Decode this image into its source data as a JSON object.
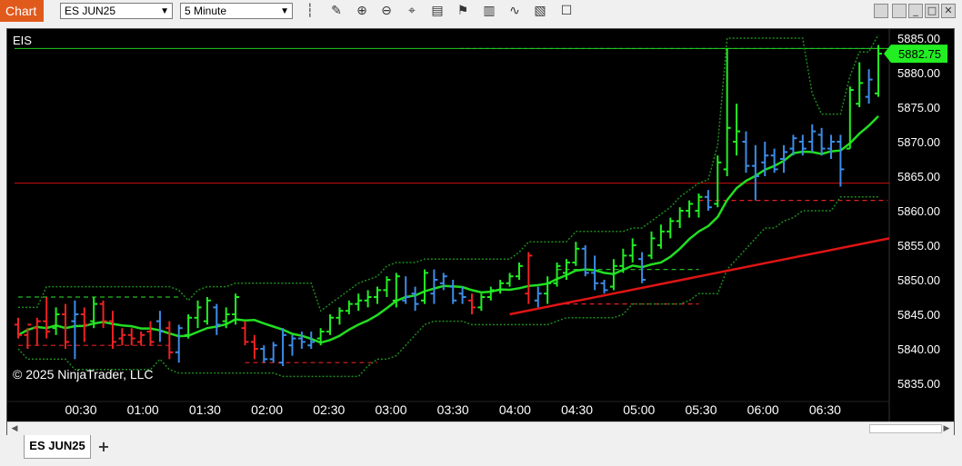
{
  "window": {
    "title": "Chart"
  },
  "toolbar": {
    "instrument": "ES JUN25",
    "interval": "5 Minute",
    "icons": [
      "bars-type-icon",
      "draw-pencil-icon",
      "zoom-in-icon",
      "zoom-out-icon",
      "crosshair-icon",
      "properties-icon",
      "strategies-icon",
      "indicators-icon",
      "templates-icon",
      "chart-trader-icon",
      "data-box-icon",
      "snapshot-icon"
    ]
  },
  "chart": {
    "instrument_label": "EIS",
    "copyright": "© 2025 NinjaTrader, LLC",
    "last_price_label": "5882.75",
    "colors": {
      "background": "#000000",
      "up": "#22ee22",
      "down": "#ee2222",
      "neutral": "#3c8ce8",
      "ma": "#22dd22",
      "trend": "#e01414"
    }
  },
  "chart_data": {
    "type": "candlestick",
    "instrument": "ES JUN25",
    "interval": "5 Minute",
    "ylim": [
      5832,
      5886
    ],
    "yticks": [
      "5885.00",
      "5880.00",
      "5875.00",
      "5870.00",
      "5865.00",
      "5860.00",
      "5855.00",
      "5850.00",
      "5845.00",
      "5840.00",
      "5835.00"
    ],
    "xticks": [
      "00:30",
      "01:00",
      "01:30",
      "02:00",
      "02:30",
      "03:00",
      "03:30",
      "04:00",
      "04:30",
      "05:00",
      "05:30",
      "06:00",
      "06:30"
    ],
    "last_price": 5882.75,
    "horizontal_lines": [
      5883.5,
      5864.0
    ],
    "bars": [
      {
        "o": 5843.5,
        "h": 5844.5,
        "l": 5841.5,
        "c": 5842.0,
        "d": "down"
      },
      {
        "o": 5842.0,
        "h": 5843.0,
        "l": 5840.0,
        "c": 5843.5,
        "d": "down"
      },
      {
        "o": 5843.0,
        "h": 5844.5,
        "l": 5840.5,
        "c": 5844.0,
        "d": "down"
      },
      {
        "o": 5844.0,
        "h": 5847.5,
        "l": 5841.5,
        "c": 5842.5,
        "d": "down"
      },
      {
        "o": 5843.0,
        "h": 5846.0,
        "l": 5842.0,
        "c": 5845.0,
        "d": "up"
      },
      {
        "o": 5845.0,
        "h": 5846.5,
        "l": 5840.0,
        "c": 5841.0,
        "d": "down"
      },
      {
        "o": 5844.0,
        "h": 5847.0,
        "l": 5838.5,
        "c": 5845.0,
        "d": "neutral"
      },
      {
        "o": 5845.0,
        "h": 5846.0,
        "l": 5841.0,
        "c": 5843.5,
        "d": "down"
      },
      {
        "o": 5844.0,
        "h": 5847.5,
        "l": 5843.0,
        "c": 5846.5,
        "d": "up"
      },
      {
        "o": 5846.5,
        "h": 5847.0,
        "l": 5843.0,
        "c": 5844.0,
        "d": "down"
      },
      {
        "o": 5844.0,
        "h": 5845.5,
        "l": 5840.0,
        "c": 5841.0,
        "d": "down"
      },
      {
        "o": 5841.5,
        "h": 5843.0,
        "l": 5840.5,
        "c": 5842.0,
        "d": "down"
      },
      {
        "o": 5842.0,
        "h": 5843.0,
        "l": 5840.5,
        "c": 5841.5,
        "d": "down"
      },
      {
        "o": 5841.0,
        "h": 5842.5,
        "l": 5840.5,
        "c": 5842.0,
        "d": "down"
      },
      {
        "o": 5842.5,
        "h": 5844.0,
        "l": 5840.5,
        "c": 5841.0,
        "d": "down"
      },
      {
        "o": 5844.0,
        "h": 5845.5,
        "l": 5841.0,
        "c": 5842.5,
        "d": "neutral"
      },
      {
        "o": 5843.0,
        "h": 5844.0,
        "l": 5838.5,
        "c": 5839.5,
        "d": "down"
      },
      {
        "o": 5839.5,
        "h": 5843.5,
        "l": 5838.0,
        "c": 5843.0,
        "d": "neutral"
      },
      {
        "o": 5842.0,
        "h": 5845.0,
        "l": 5841.5,
        "c": 5844.5,
        "d": "up"
      },
      {
        "o": 5844.5,
        "h": 5847.0,
        "l": 5843.0,
        "c": 5846.0,
        "d": "up"
      },
      {
        "o": 5844.0,
        "h": 5847.5,
        "l": 5843.5,
        "c": 5847.0,
        "d": "up"
      },
      {
        "o": 5846.0,
        "h": 5846.5,
        "l": 5842.0,
        "c": 5843.5,
        "d": "neutral"
      },
      {
        "o": 5844.0,
        "h": 5846.0,
        "l": 5843.0,
        "c": 5845.0,
        "d": "up"
      },
      {
        "o": 5845.0,
        "h": 5848.0,
        "l": 5843.5,
        "c": 5847.5,
        "d": "up"
      },
      {
        "o": 5843.0,
        "h": 5844.0,
        "l": 5840.5,
        "c": 5841.0,
        "d": "down"
      },
      {
        "o": 5841.0,
        "h": 5842.0,
        "l": 5838.5,
        "c": 5840.0,
        "d": "down"
      },
      {
        "o": 5840.0,
        "h": 5840.5,
        "l": 5838.0,
        "c": 5838.5,
        "d": "neutral"
      },
      {
        "o": 5838.5,
        "h": 5841.0,
        "l": 5838.0,
        "c": 5840.5,
        "d": "neutral"
      },
      {
        "o": 5838.0,
        "h": 5843.0,
        "l": 5837.5,
        "c": 5842.0,
        "d": "neutral"
      },
      {
        "o": 5840.5,
        "h": 5842.0,
        "l": 5839.0,
        "c": 5841.5,
        "d": "neutral"
      },
      {
        "o": 5841.5,
        "h": 5842.5,
        "l": 5840.0,
        "c": 5841.0,
        "d": "neutral"
      },
      {
        "o": 5840.5,
        "h": 5842.5,
        "l": 5840.0,
        "c": 5841.0,
        "d": "neutral"
      },
      {
        "o": 5841.5,
        "h": 5843.0,
        "l": 5840.5,
        "c": 5842.5,
        "d": "up"
      },
      {
        "o": 5842.5,
        "h": 5845.0,
        "l": 5842.0,
        "c": 5844.5,
        "d": "up"
      },
      {
        "o": 5844.5,
        "h": 5846.0,
        "l": 5843.5,
        "c": 5845.5,
        "d": "up"
      },
      {
        "o": 5845.5,
        "h": 5847.0,
        "l": 5845.0,
        "c": 5846.5,
        "d": "up"
      },
      {
        "o": 5846.5,
        "h": 5848.0,
        "l": 5845.5,
        "c": 5847.0,
        "d": "up"
      },
      {
        "o": 5847.0,
        "h": 5848.5,
        "l": 5846.0,
        "c": 5847.5,
        "d": "up"
      },
      {
        "o": 5847.5,
        "h": 5849.0,
        "l": 5846.5,
        "c": 5848.5,
        "d": "up"
      },
      {
        "o": 5848.5,
        "h": 5850.5,
        "l": 5847.5,
        "c": 5850.0,
        "d": "up"
      },
      {
        "o": 5847.0,
        "h": 5851.0,
        "l": 5846.0,
        "c": 5850.5,
        "d": "up"
      },
      {
        "o": 5847.0,
        "h": 5850.5,
        "l": 5846.5,
        "c": 5847.5,
        "d": "neutral"
      },
      {
        "o": 5848.0,
        "h": 5849.0,
        "l": 5845.5,
        "c": 5846.5,
        "d": "neutral"
      },
      {
        "o": 5847.0,
        "h": 5851.5,
        "l": 5846.5,
        "c": 5851.0,
        "d": "up"
      },
      {
        "o": 5848.0,
        "h": 5851.5,
        "l": 5846.5,
        "c": 5850.0,
        "d": "neutral"
      },
      {
        "o": 5849.5,
        "h": 5851.0,
        "l": 5848.5,
        "c": 5850.5,
        "d": "neutral"
      },
      {
        "o": 5849.0,
        "h": 5850.0,
        "l": 5846.5,
        "c": 5847.0,
        "d": "neutral"
      },
      {
        "o": 5848.0,
        "h": 5849.0,
        "l": 5846.5,
        "c": 5847.5,
        "d": "neutral"
      },
      {
        "o": 5847.0,
        "h": 5848.0,
        "l": 5845.0,
        "c": 5846.0,
        "d": "down"
      },
      {
        "o": 5846.0,
        "h": 5848.0,
        "l": 5845.5,
        "c": 5847.5,
        "d": "up"
      },
      {
        "o": 5847.5,
        "h": 5849.0,
        "l": 5847.0,
        "c": 5848.5,
        "d": "up"
      },
      {
        "o": 5848.5,
        "h": 5850.0,
        "l": 5848.0,
        "c": 5849.5,
        "d": "up"
      },
      {
        "o": 5849.5,
        "h": 5851.0,
        "l": 5849.0,
        "c": 5850.5,
        "d": "up"
      },
      {
        "o": 5850.5,
        "h": 5852.5,
        "l": 5850.0,
        "c": 5852.0,
        "d": "up"
      },
      {
        "o": 5848.0,
        "h": 5854.0,
        "l": 5846.5,
        "c": 5853.5,
        "d": "down"
      },
      {
        "o": 5847.0,
        "h": 5849.0,
        "l": 5846.0,
        "c": 5848.0,
        "d": "neutral"
      },
      {
        "o": 5848.0,
        "h": 5850.5,
        "l": 5846.5,
        "c": 5849.5,
        "d": "up"
      },
      {
        "o": 5849.5,
        "h": 5852.5,
        "l": 5849.0,
        "c": 5852.0,
        "d": "up"
      },
      {
        "o": 5851.0,
        "h": 5853.0,
        "l": 5850.0,
        "c": 5852.5,
        "d": "up"
      },
      {
        "o": 5852.5,
        "h": 5855.5,
        "l": 5852.0,
        "c": 5854.5,
        "d": "up"
      },
      {
        "o": 5854.5,
        "h": 5855.0,
        "l": 5850.5,
        "c": 5851.0,
        "d": "neutral"
      },
      {
        "o": 5851.0,
        "h": 5853.5,
        "l": 5848.5,
        "c": 5849.5,
        "d": "neutral"
      },
      {
        "o": 5849.5,
        "h": 5850.0,
        "l": 5848.0,
        "c": 5848.5,
        "d": "neutral"
      },
      {
        "o": 5849.0,
        "h": 5853.0,
        "l": 5848.5,
        "c": 5852.0,
        "d": "up"
      },
      {
        "o": 5852.0,
        "h": 5854.5,
        "l": 5851.0,
        "c": 5853.5,
        "d": "up"
      },
      {
        "o": 5853.5,
        "h": 5856.0,
        "l": 5852.5,
        "c": 5855.0,
        "d": "up"
      },
      {
        "o": 5853.0,
        "h": 5854.0,
        "l": 5849.5,
        "c": 5850.0,
        "d": "neutral"
      },
      {
        "o": 5853.5,
        "h": 5857.0,
        "l": 5853.0,
        "c": 5856.0,
        "d": "up"
      },
      {
        "o": 5855.0,
        "h": 5858.0,
        "l": 5854.5,
        "c": 5857.0,
        "d": "up"
      },
      {
        "o": 5857.0,
        "h": 5859.0,
        "l": 5856.0,
        "c": 5858.5,
        "d": "up"
      },
      {
        "o": 5858.5,
        "h": 5860.5,
        "l": 5857.5,
        "c": 5860.0,
        "d": "up"
      },
      {
        "o": 5860.0,
        "h": 5861.5,
        "l": 5859.0,
        "c": 5861.0,
        "d": "up"
      },
      {
        "o": 5860.0,
        "h": 5862.5,
        "l": 5859.0,
        "c": 5862.0,
        "d": "up"
      },
      {
        "o": 5862.0,
        "h": 5863.0,
        "l": 5860.0,
        "c": 5860.5,
        "d": "neutral"
      },
      {
        "o": 5861.0,
        "h": 5868.0,
        "l": 5860.5,
        "c": 5867.0,
        "d": "up"
      },
      {
        "o": 5866.0,
        "h": 5883.5,
        "l": 5865.0,
        "c": 5872.0,
        "d": "up"
      },
      {
        "o": 5870.0,
        "h": 5875.5,
        "l": 5868.0,
        "c": 5871.5,
        "d": "up"
      },
      {
        "o": 5870.0,
        "h": 5871.5,
        "l": 5865.5,
        "c": 5866.5,
        "d": "neutral"
      },
      {
        "o": 5866.5,
        "h": 5869.5,
        "l": 5861.5,
        "c": 5865.0,
        "d": "neutral"
      },
      {
        "o": 5867.0,
        "h": 5870.0,
        "l": 5865.0,
        "c": 5868.0,
        "d": "neutral"
      },
      {
        "o": 5868.0,
        "h": 5869.0,
        "l": 5865.5,
        "c": 5866.0,
        "d": "neutral"
      },
      {
        "o": 5867.5,
        "h": 5869.5,
        "l": 5865.5,
        "c": 5868.5,
        "d": "neutral"
      },
      {
        "o": 5869.0,
        "h": 5871.0,
        "l": 5868.0,
        "c": 5870.5,
        "d": "neutral"
      },
      {
        "o": 5870.0,
        "h": 5871.0,
        "l": 5868.0,
        "c": 5869.0,
        "d": "neutral"
      },
      {
        "o": 5870.0,
        "h": 5872.5,
        "l": 5868.5,
        "c": 5871.5,
        "d": "neutral"
      },
      {
        "o": 5871.0,
        "h": 5872.0,
        "l": 5868.0,
        "c": 5869.0,
        "d": "neutral"
      },
      {
        "o": 5869.0,
        "h": 5871.0,
        "l": 5867.5,
        "c": 5870.0,
        "d": "neutral"
      },
      {
        "o": 5870.0,
        "h": 5871.0,
        "l": 5863.5,
        "c": 5866.0,
        "d": "neutral"
      },
      {
        "o": 5869.0,
        "h": 5878.0,
        "l": 5869.0,
        "c": 5877.5,
        "d": "up"
      },
      {
        "o": 5875.5,
        "h": 5881.5,
        "l": 5875.0,
        "c": 5878.5,
        "d": "up"
      },
      {
        "o": 5876.5,
        "h": 5880.5,
        "l": 5875.5,
        "c": 5879.0,
        "d": "neutral"
      },
      {
        "o": 5877.0,
        "h": 5884.0,
        "l": 5876.5,
        "c": 5882.75,
        "d": "up"
      }
    ]
  },
  "tabs": {
    "active": "ES JUN25",
    "add": "+"
  }
}
